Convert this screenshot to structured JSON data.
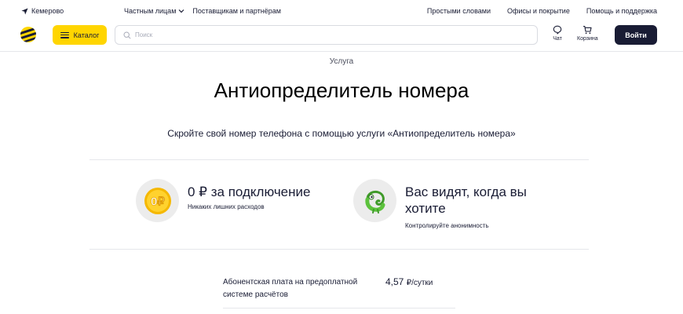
{
  "topbar": {
    "city": "Кемерово",
    "segments": [
      {
        "label": "Частным лицам"
      },
      {
        "label": "Поставщикам и партнёрам"
      }
    ],
    "links": [
      "Простыми словами",
      "Офисы и покрытие",
      "Помощь и поддержка"
    ]
  },
  "header": {
    "catalog_label": "Каталог",
    "search_placeholder": "Поиск",
    "chat_label": "Чат",
    "cart_label": "Корзина",
    "login_label": "Войти"
  },
  "main": {
    "eyebrow": "Услуга",
    "title": "Антиопределитель номера",
    "subtitle": "Скройте свой номер телефона с помощью услуги «Антиопределитель номера»",
    "features": [
      {
        "icon": "coin-0-rub-icon",
        "badge": "0₽",
        "title": "0 ₽ за подключение",
        "subtitle": "Никаких лишних расходов"
      },
      {
        "icon": "chameleon-icon",
        "title": "Вас видят, когда вы хотите",
        "subtitle": "Контролируйте анонимность"
      }
    ],
    "price": {
      "label": "Абонентская плата на предоплатной системе расчётов",
      "amount": "4,57",
      "unit": "₽/сутки"
    }
  },
  "colors": {
    "brand_yellow": "#ffd500",
    "dark": "#191c34",
    "divider": "#e5e7eb"
  }
}
